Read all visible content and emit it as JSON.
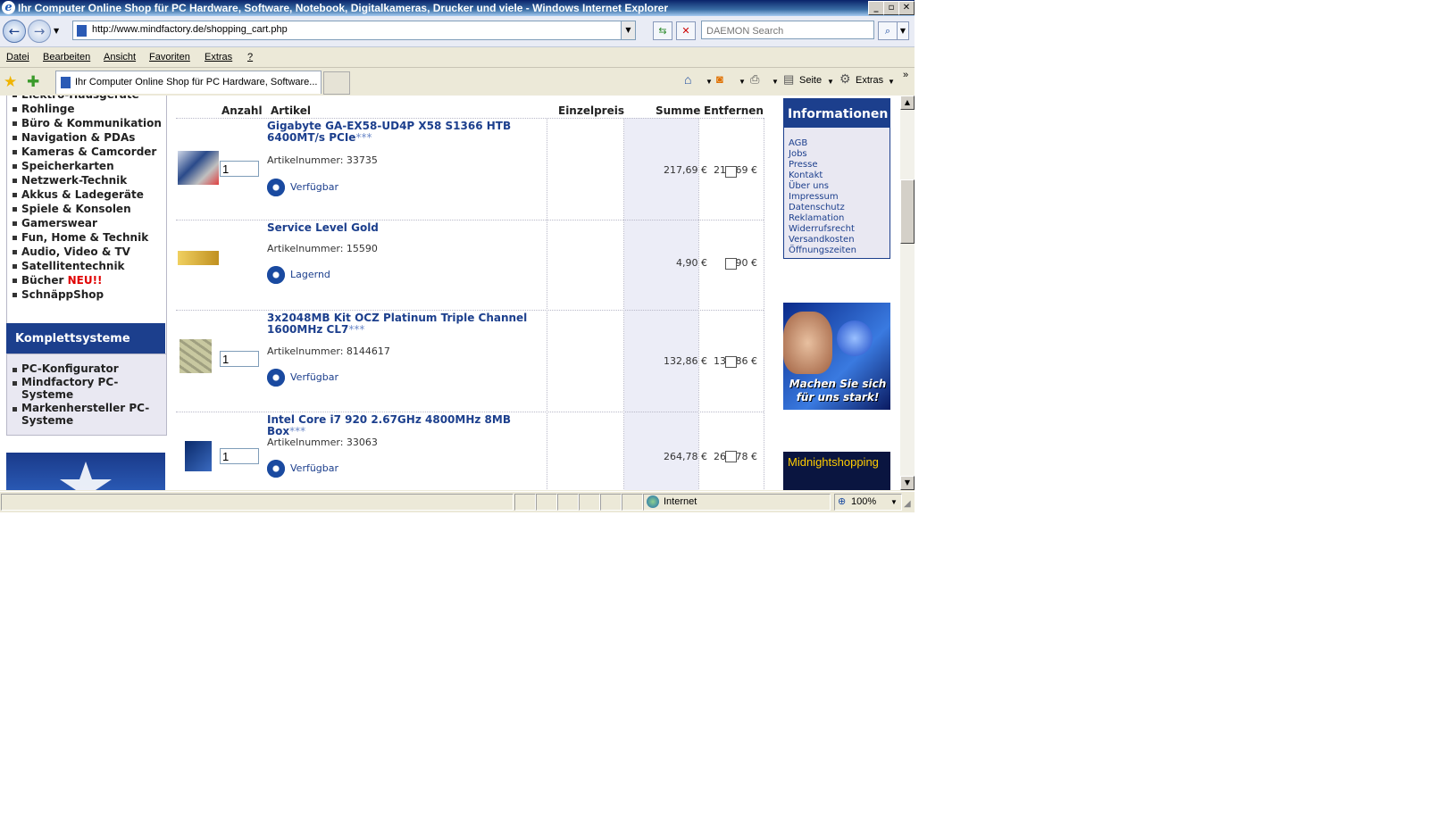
{
  "window": {
    "title": "Ihr Computer Online Shop für PC Hardware, Software, Notebook, Digitalkameras, Drucker und viele - Windows Internet Explorer",
    "ie_logo": "e"
  },
  "addressbar": {
    "url": "http://www.mindfactory.de/shopping_cart.php",
    "search_placeholder": "DAEMON Search"
  },
  "menu": [
    "Datei",
    "Bearbeiten",
    "Ansicht",
    "Favoriten",
    "Extras",
    "?"
  ],
  "tab": {
    "label": "Ihr Computer Online Shop für PC Hardware, Software..."
  },
  "toolbar": {
    "seite": "Seite",
    "extras": "Extras"
  },
  "left_nav": {
    "items": [
      {
        "label": "Elektro-Hausgeräte"
      },
      {
        "label": "Rohlinge"
      },
      {
        "label": "Büro & Kommunikation"
      },
      {
        "label": "Navigation & PDAs"
      },
      {
        "label": "Kameras & Camcorder"
      },
      {
        "label": "Speicherkarten"
      },
      {
        "label": "Netzwerk-Technik"
      },
      {
        "label": "Akkus & Ladegeräte"
      },
      {
        "label": "Spiele & Konsolen"
      },
      {
        "label": "Gamerswear"
      },
      {
        "label": "Fun, Home & Technik"
      },
      {
        "label": "Audio, Video & TV"
      },
      {
        "label": "Satellitentechnik"
      },
      {
        "label": "Bücher",
        "badge": "NEU!!"
      },
      {
        "label": "SchnäppShop"
      }
    ],
    "komplett_title": "Komplettsysteme",
    "komplett_items": [
      "PC-Konfigurator",
      "Mindfactory PC-Systeme",
      "Markenhersteller PC-Systeme"
    ]
  },
  "cart": {
    "headers": {
      "anzahl": "Anzahl",
      "artikel": "Artikel",
      "einzelpreis": "Einzelpreis",
      "summe": "Summe",
      "entfernen": "Entfernen"
    },
    "rows": [
      {
        "name": "Gigabyte GA-EX58-UD4P X58 S1366 HTB 6400MT/s PCIe",
        "stars": "***",
        "qty": "1",
        "artnr": "Artikelnummer: 33735",
        "status": "Verfügbar",
        "einzelpreis": "217,69 €",
        "summe": "217,69 €"
      },
      {
        "name": "Service Level Gold",
        "stars": "",
        "qty": "",
        "artnr": "Artikelnummer: 15590",
        "status": "Lagernd",
        "einzelpreis": "4,90 €",
        "summe": "4,90 €"
      },
      {
        "name": "3x2048MB Kit OCZ Platinum Triple Channel 1600MHz CL7",
        "stars": "***",
        "qty": "1",
        "artnr": "Artikelnummer: 8144617",
        "status": "Verfügbar",
        "einzelpreis": "132,86 €",
        "summe": "132,86 €"
      },
      {
        "name": "Intel Core i7 920 2.67GHz 4800MHz 8MB Box",
        "stars": "***",
        "qty": "1",
        "artnr": "Artikelnummer: 33063",
        "status": "Verfügbar",
        "einzelpreis": "264,78 €",
        "summe": "264,78 €"
      }
    ]
  },
  "info_box": {
    "title": "Informationen",
    "links": [
      "AGB",
      "Jobs",
      "Presse",
      "Kontakt",
      "Über uns",
      "Impressum",
      "Datenschutz",
      "Reklamation",
      "Widerrufsrecht",
      "Versandkosten",
      "Öffnungszeiten"
    ]
  },
  "banners": {
    "fitness_text": "Machen Sie sich für uns stark!",
    "midnight": "Midnightshopping"
  },
  "statusbar": {
    "zone": "Internet",
    "zoom": "100%"
  }
}
